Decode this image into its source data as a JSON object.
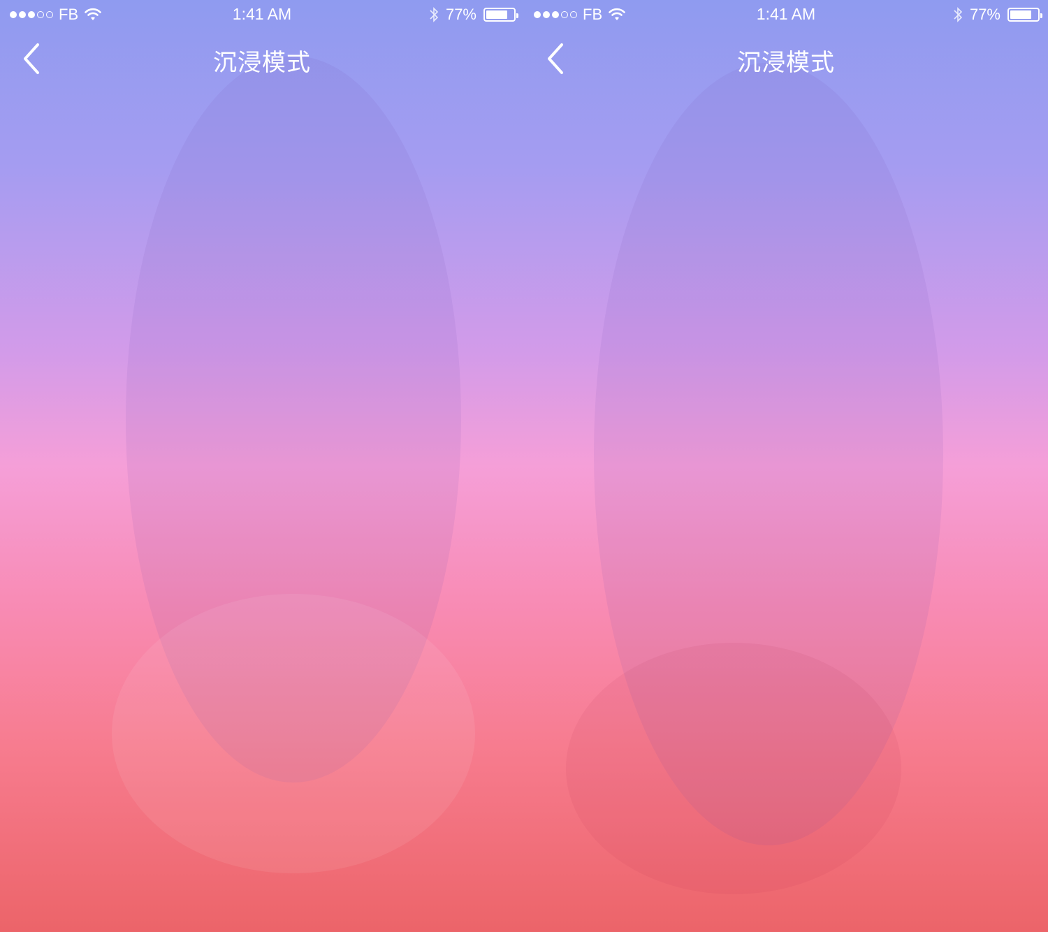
{
  "screens": [
    {
      "status_bar": {
        "carrier": "FB",
        "signal_filled": 3,
        "signal_total": 5,
        "time": "1:41 AM",
        "battery_percent_label": "77%",
        "battery_level": 0.77
      },
      "nav": {
        "title": "沉浸模式",
        "back_icon": "chevron-left-icon"
      },
      "content": {
        "type": "full-bleed photo with pink/purple gradient overlay"
      }
    },
    {
      "status_bar": {
        "carrier": "FB",
        "signal_filled": 3,
        "signal_total": 5,
        "time": "1:41 AM",
        "battery_percent_label": "77%",
        "battery_level": 0.77
      },
      "nav": {
        "title": "沉浸模式",
        "back_icon": "chevron-left-icon"
      },
      "content": {
        "type": "full-bleed photo with pink/purple gradient overlay"
      }
    }
  ],
  "colors": {
    "gradient_top": "#8f9bf0",
    "gradient_mid": "#f59fd8",
    "gradient_bottom": "#ec6469",
    "text": "#ffffff"
  }
}
